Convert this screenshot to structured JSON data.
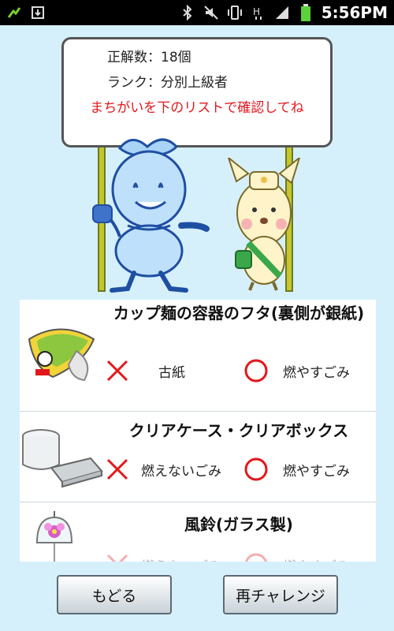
{
  "status_bar": {
    "time": "5:56PM",
    "icons": [
      "usb-debug-icon",
      "download-icon",
      "bluetooth-icon",
      "mute-icon",
      "vibrate-icon",
      "hspa-signal-icon",
      "signal-strength-icon",
      "battery-icon"
    ]
  },
  "sign": {
    "correct_count_label": "正解数：18個",
    "rank_label": "ランク：分別上級者",
    "note": "まちがいを下のリストで確認してね"
  },
  "items": [
    {
      "title": "カップ麺の容器のフタ(裏側が銀紙)",
      "wrong_answer": "古紙",
      "correct_answer": "燃やすごみ",
      "icon": "cup-noodle-lid-icon"
    },
    {
      "title": "クリアケース・クリアボックス",
      "wrong_answer": "燃えないごみ",
      "correct_answer": "燃やすごみ",
      "icon": "clear-case-icon"
    },
    {
      "title": "風鈴(ガラス製)",
      "wrong_answer": "燃えないごみ",
      "correct_answer": "燃やすごみ",
      "icon": "glass-wind-chime-icon"
    }
  ],
  "buttons": {
    "back": "もどる",
    "retry": "再チャレンジ"
  },
  "colors": {
    "background": "#d6f0fb",
    "wrong_mark": "#e2171b",
    "note_text": "#e2171b"
  }
}
